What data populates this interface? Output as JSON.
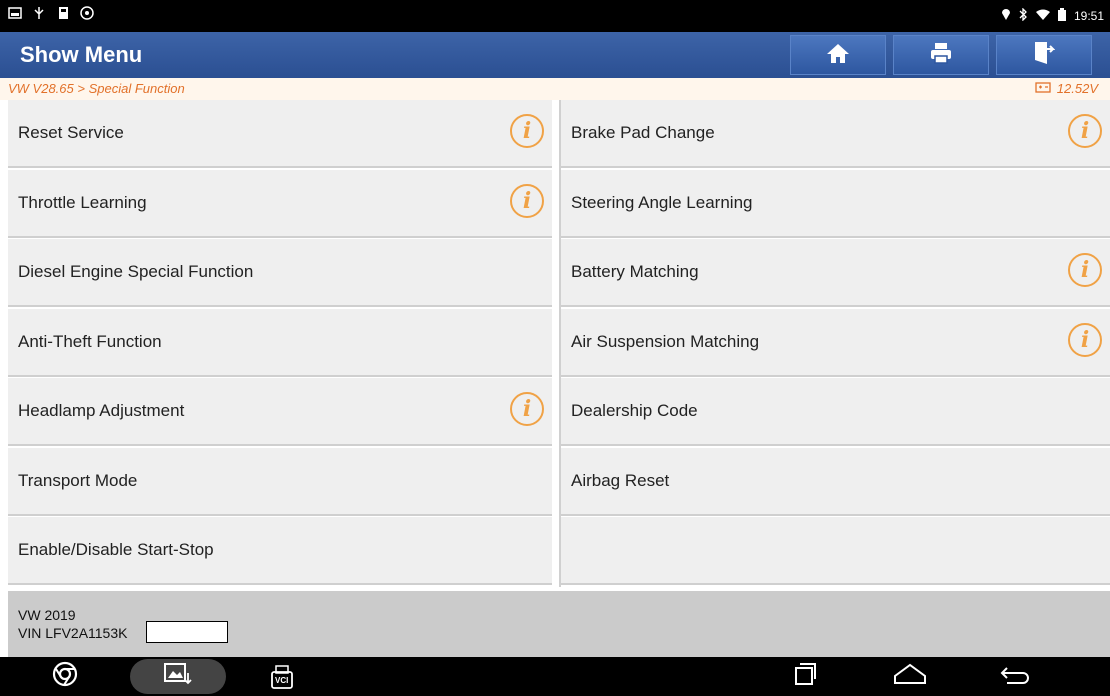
{
  "status_bar": {
    "time": "19:51"
  },
  "header": {
    "title": "Show Menu"
  },
  "breadcrumb": {
    "text": "VW V28.65 > Special Function",
    "voltage": "12.52V"
  },
  "menu": {
    "left": [
      {
        "label": "Reset Service",
        "info": true
      },
      {
        "label": "Throttle Learning",
        "info": true
      },
      {
        "label": "Diesel Engine Special Function",
        "info": false
      },
      {
        "label": "Anti-Theft Function",
        "info": false
      },
      {
        "label": "Headlamp Adjustment",
        "info": true
      },
      {
        "label": "Transport Mode",
        "info": false
      },
      {
        "label": "Enable/Disable Start-Stop",
        "info": false
      }
    ],
    "right": [
      {
        "label": "Brake Pad Change",
        "info": true
      },
      {
        "label": "Steering Angle Learning",
        "info": false
      },
      {
        "label": "Battery Matching",
        "info": true
      },
      {
        "label": "Air Suspension Matching",
        "info": true
      },
      {
        "label": "Dealership Code",
        "info": false
      },
      {
        "label": "Airbag Reset",
        "info": false
      },
      {
        "label": "",
        "info": false
      }
    ],
    "info_glyph": "i"
  },
  "footer": {
    "vehicle": "VW  2019",
    "vin": "VIN LFV2A1153K"
  },
  "nav": {
    "vci_label": "VCI"
  },
  "colors": {
    "header_blue": "#2f5597",
    "accent_orange": "#f0a246",
    "crumb_orange": "#e2712a"
  }
}
